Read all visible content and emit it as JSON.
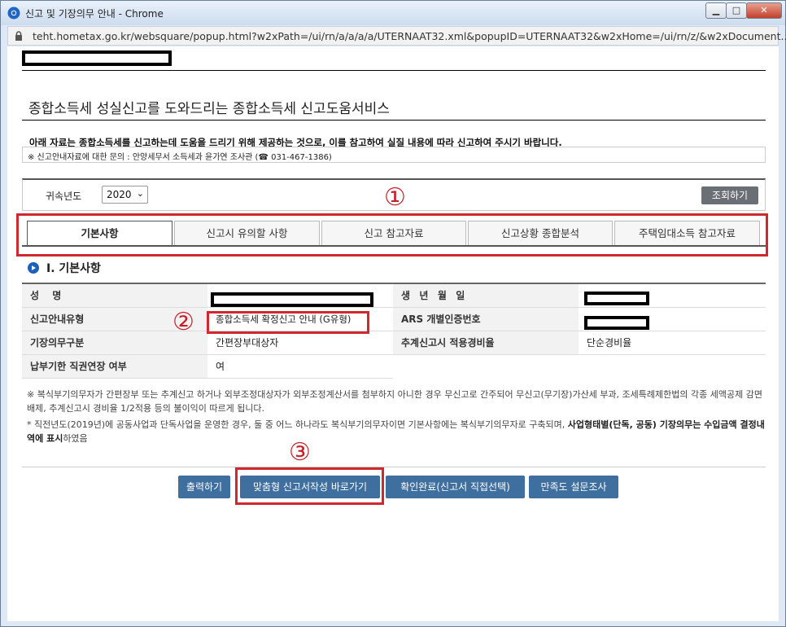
{
  "window": {
    "title": "신고 및 기장의무 안내 - Chrome",
    "url": "teht.hometax.go.kr/websquare/popup.html?w2xPath=/ui/rn/a/a/a/a/UTERNAAT32.xml&popupID=UTERNAAT32&w2xHome=/ui/rn/z/&w2xDocument..."
  },
  "page": {
    "title": "종합소득세 성실신고를 도와드리는 종합소득세 신고도움서비스",
    "notice": "아래 자료는 종합소득세를 신고하는데 도움을 드리기 위해 제공하는 것으로, 이를 참고하여 실질 내용에 따라 신고하여 주시기 바랍니다.",
    "inquiry": "※ 신고안내자료에 대한 문의 : 안양세무서 소득세과 윤가연 조사관 (☎ 031-467-1386)"
  },
  "search": {
    "year_label": "귀속년도",
    "year_value": "2020",
    "query_button": "조회하기"
  },
  "tabs": [
    "기본사항",
    "신고시 유의할 사항",
    "신고 참고자료",
    "신고상황 종합분석",
    "주택임대소득 참고자료"
  ],
  "section": {
    "title": "Ⅰ. 기본사항"
  },
  "info": {
    "name_label": "성 명",
    "birth_label": "생 년 월 일",
    "guide_type_label": "신고안내유형",
    "guide_type_value": "종합소득세 확정신고 안내 (G유형)",
    "ars_label": "ARS 개별인증번호",
    "bookkeeping_label": "기장의무구분",
    "bookkeeping_value": "간편장부대상자",
    "estimate_label": "추계신고시 적용경비율",
    "estimate_value": "단순경비율",
    "extension_label": "납부기한 직권연장 여부",
    "extension_value": "여"
  },
  "notes": {
    "note1": "※ 복식부기의무자가 간편장부 또는 추계신고 하거나 외부조정대상자가 외부조정계산서를 첨부하지 아니한 경우 무신고로 간주되어 무신고(무기장)가산세 부과, 조세특례제한법의 각종 세액공제 감면 배제, 추계신고시 경비율 1/2적용 등의 불이익이 따르게 됩니다.",
    "note2_a": "* 직전년도(2019년)에 공동사업과 단독사업을 운영한 경우, 둘 중 어느 하나라도 복식부기의무자이면 기본사항에는 복식부기의무자로 구축되며, ",
    "note2_b": "사업형태별(단독, 공동) 기장의무는 수입금액 결정내역에 표시",
    "note2_c": "하였음"
  },
  "buttons": {
    "print": "출력하기",
    "custom_report": "맞춤형 신고서작성 바로가기",
    "confirm": "확인완료(신고서 직접선택)",
    "survey": "만족도 설문조사"
  },
  "annotations": [
    "①",
    "②",
    "③"
  ],
  "colors": {
    "annotation_red": "#d0282f",
    "button_blue": "#3e6f9f",
    "query_button_gray": "#6a6f76"
  }
}
